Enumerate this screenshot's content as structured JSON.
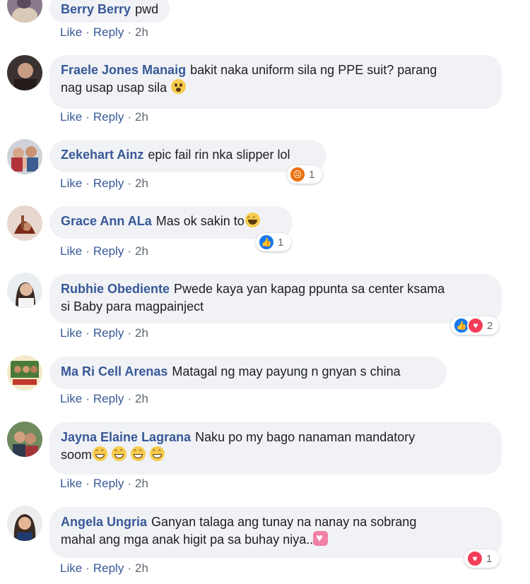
{
  "colors": {
    "author": "#385898",
    "bubble": "#f0f2f5",
    "action_link": "#385898",
    "meta_text": "#606770",
    "like_blue": "#1877f2",
    "love_red": "#f33e58",
    "angry_orange": "#e9710f"
  },
  "actions": {
    "like": "Like",
    "reply": "Reply"
  },
  "comments": [
    {
      "author": "Berry Berry",
      "text": "pwd",
      "time": "2h"
    },
    {
      "author": "Fraele Jones Manaig",
      "text": "bakit naka uniform sila ng PPE suit? parang",
      "text2": "nag usap usap sila",
      "emoji": "shocked-face-icon",
      "time": "2h"
    },
    {
      "author": "Zekehart Ainz",
      "text": "epic fail rin nka slipper lol",
      "time": "2h",
      "reaction": {
        "icons": [
          "angry"
        ],
        "count": "1"
      }
    },
    {
      "author": "Grace Ann ALa",
      "text": "Mas ok sakin to",
      "emoji": "laughing-face-icon",
      "time": "2h",
      "reaction": {
        "icons": [
          "like"
        ],
        "count": "1"
      }
    },
    {
      "author": "Rubhie Obediente",
      "text": "Pwede kaya yan kapag ppunta sa center ksama",
      "text2": "si Baby para magpainject",
      "time": "2h",
      "reaction": {
        "icons": [
          "like",
          "love"
        ],
        "count": "2"
      }
    },
    {
      "author": "Ma Ri Cell Arenas",
      "text": "Matagal ng may payung n gnyan s china",
      "time": "2h"
    },
    {
      "author": "Jayna Elaine Lagrana",
      "text": "Naku po my bago nanaman mandatory",
      "text2": "soom",
      "emoji": "grinning-face-icon",
      "time": "2h"
    },
    {
      "author": "Angela Ungria",
      "text": "Ganyan talaga ang tunay na nanay na sobrang",
      "text2": "mahal ang mga anak higit pa sa buhay niya..",
      "emoji": "heart-icon",
      "time": "2h",
      "reaction": {
        "icons": [
          "love"
        ],
        "count": "1"
      }
    }
  ]
}
